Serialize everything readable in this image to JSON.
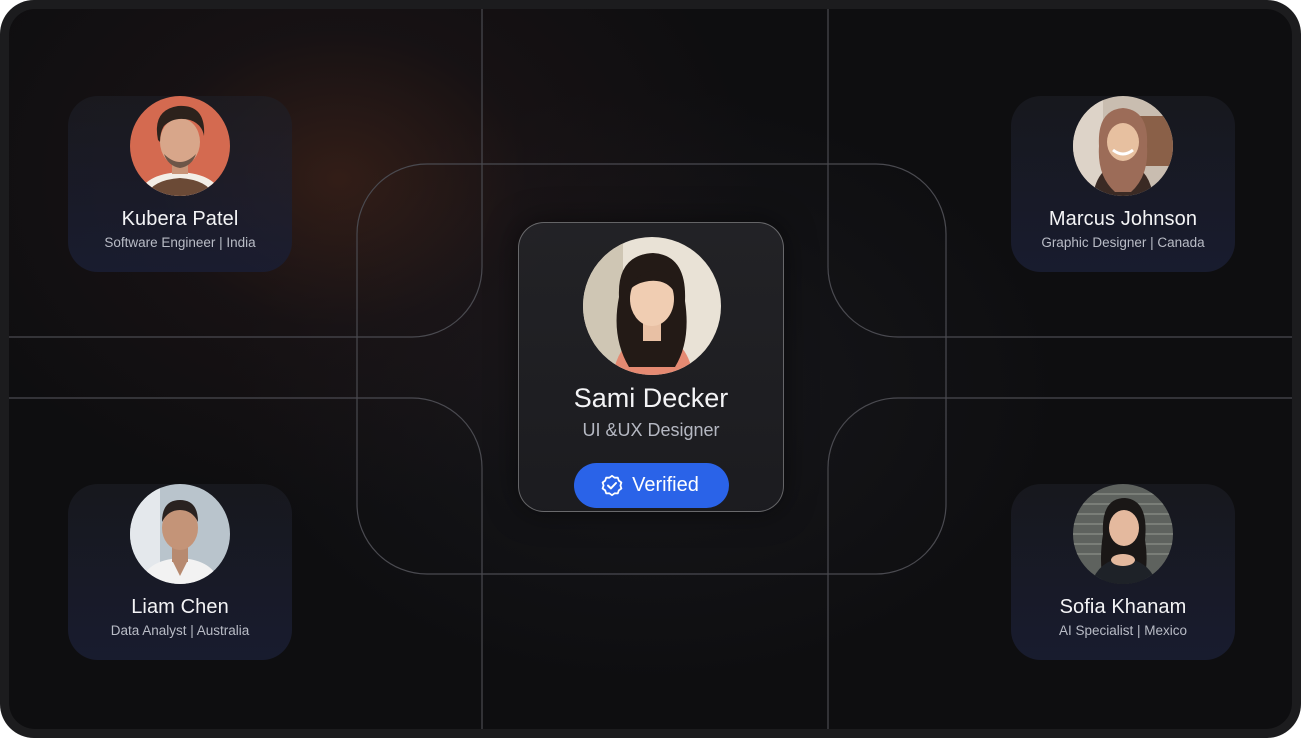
{
  "center_profile": {
    "name": "Sami Decker",
    "role": "UI &UX Designer",
    "badge_label": "Verified",
    "badge_icon": "verified-check-icon"
  },
  "profiles": [
    {
      "name": "Kubera Patel",
      "role": "Software Engineer | India"
    },
    {
      "name": "Marcus Johnson",
      "role": "Graphic Designer | Canada"
    },
    {
      "name": "Liam Chen",
      "role": "Data Analyst | Australia"
    },
    {
      "name": "Sofia Khanam",
      "role": "AI Specialist | Mexico"
    }
  ],
  "colors": {
    "background": "#0e0e10",
    "card": "#1e2236",
    "badge": "#2a63e8",
    "text": "#f4f4f6",
    "subtext": "#b9bcc6",
    "lines": "#4a4a50"
  }
}
